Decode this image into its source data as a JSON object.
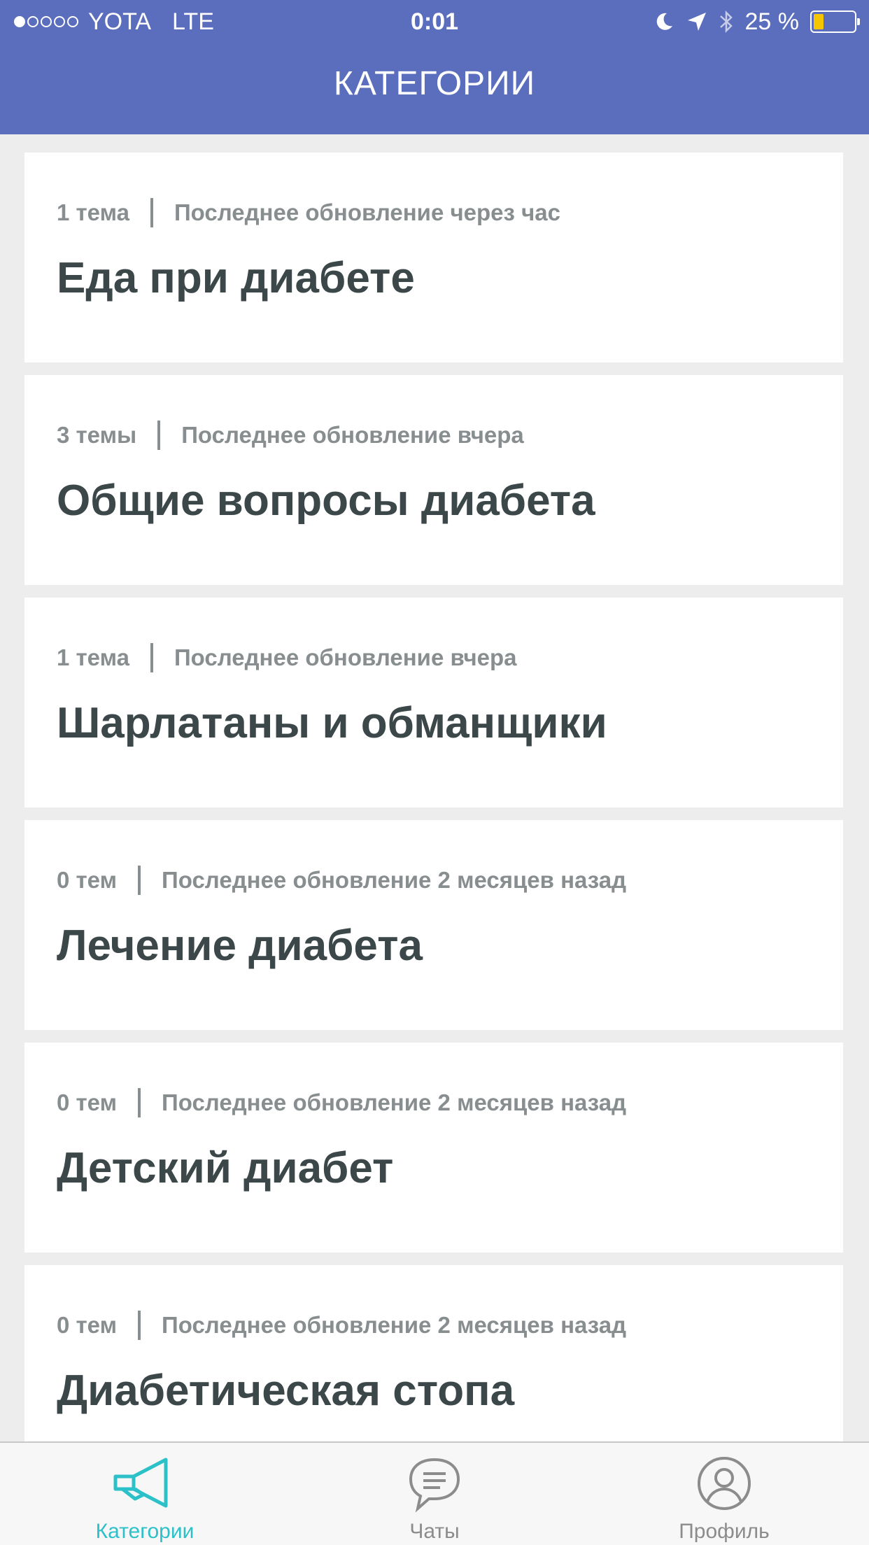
{
  "status_bar": {
    "carrier": "YOTA",
    "network": "LTE",
    "time": "0:01",
    "battery": "25 %",
    "battery_level": 0.25
  },
  "header": {
    "title": "КАТЕГОРИИ"
  },
  "categories": [
    {
      "topics": "1 тема",
      "updated": "Последнее обновление через час",
      "title": "Еда при диабете"
    },
    {
      "topics": "3 темы",
      "updated": "Последнее обновление вчера",
      "title": "Общие вопросы диабета"
    },
    {
      "topics": "1 тема",
      "updated": "Последнее обновление вчера",
      "title": "Шарлатаны и обманщики"
    },
    {
      "topics": "0 тем",
      "updated": "Последнее обновление 2 месяцев назад",
      "title": "Лечение диабета"
    },
    {
      "topics": "0 тем",
      "updated": "Последнее обновление 2 месяцев назад",
      "title": "Детский диабет"
    },
    {
      "topics": "0 тем",
      "updated": "Последнее обновление 2 месяцев назад",
      "title": "Диабетическая стопа"
    }
  ],
  "tabbar": {
    "tabs": [
      {
        "label": "Категории",
        "icon": "megaphone-icon",
        "active": true
      },
      {
        "label": "Чаты",
        "icon": "chat-bubble-icon",
        "active": false
      },
      {
        "label": "Профиль",
        "icon": "profile-icon",
        "active": false
      }
    ]
  },
  "colors": {
    "header": "#5b6dbd",
    "accent": "#2cc0c8",
    "battery": "#f7c500"
  }
}
